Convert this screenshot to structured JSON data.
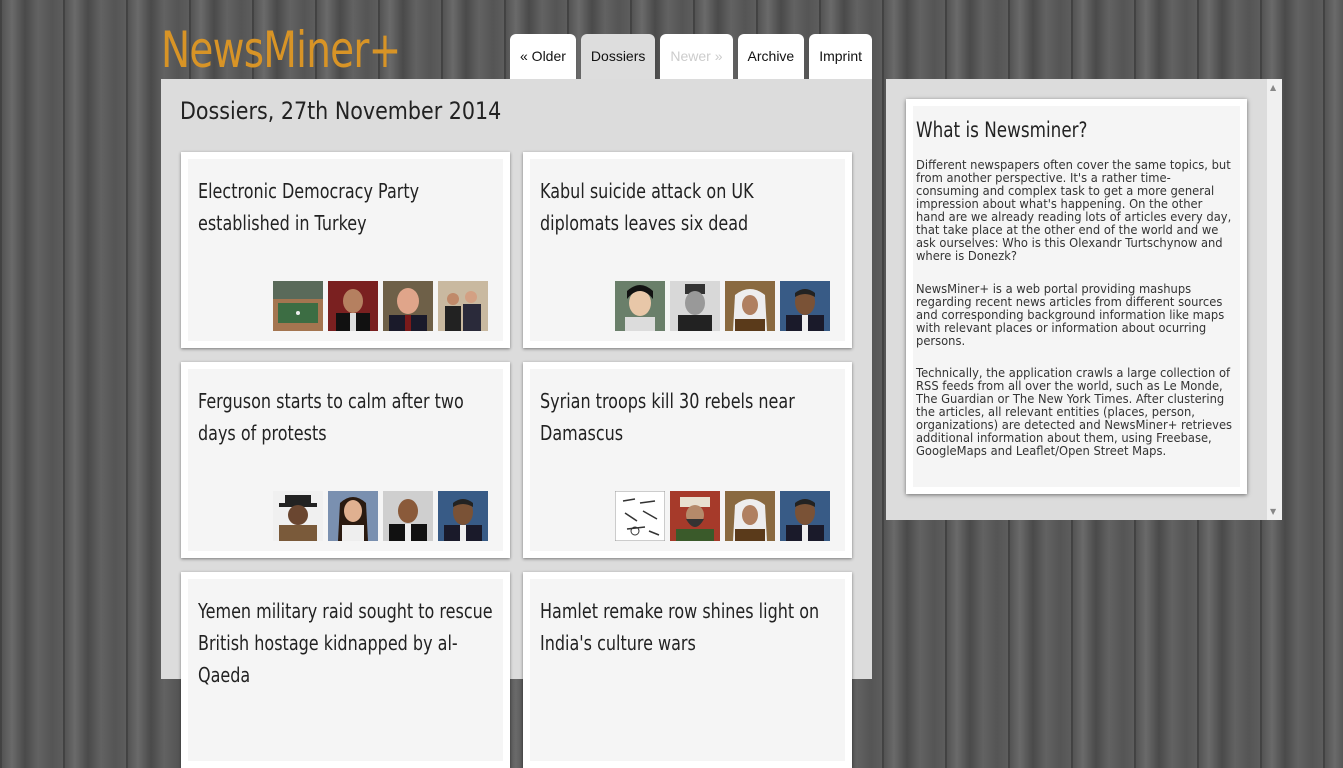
{
  "site": {
    "logo": "NewsMiner+"
  },
  "nav": {
    "older": "« Older",
    "dossiers": "Dossiers",
    "newer": "Newer »",
    "archive": "Archive",
    "imprint": "Imprint"
  },
  "main": {
    "title": "Dossiers, 27th November 2014",
    "cards": [
      {
        "title": "Electronic Democracy Party established in Turkey",
        "thumbs": [
          "tennis-court-photo",
          "politician-portrait",
          "politician-portrait",
          "group-photo"
        ]
      },
      {
        "title": "Kabul suicide attack on UK diplomats leaves six dead",
        "thumbs": [
          "woman-portrait",
          "historic-portrait",
          "king-portrait",
          "president-portrait"
        ]
      },
      {
        "title": "Ferguson starts to calm after two days of protests",
        "thumbs": [
          "man-hat-portrait",
          "woman-portrait",
          "man-portrait",
          "president-portrait"
        ]
      },
      {
        "title": "Syrian troops kill 30 rebels near Damascus",
        "thumbs": [
          "drawing-image",
          "cleric-portrait",
          "king-portrait",
          "president-portrait"
        ]
      },
      {
        "title": "Yemen military raid sought to rescue British hostage kidnapped by al-Qaeda",
        "thumbs": []
      },
      {
        "title": "Hamlet remake row shines light on India's culture wars",
        "thumbs": []
      }
    ]
  },
  "sidebar": {
    "title": "What is Newsminer?",
    "paragraphs": [
      "Different newspapers often cover the same topics, but from another perspective. It's a rather time-consuming and complex task to get a more general impression about what's happening. On the other hand are we already reading lots of articles every day, that take place at the other end of the world and we ask ourselves: Who is this Olexandr Turtschynow and where is Donezk?",
      "NewsMiner+ is a web portal providing mashups regarding recent news articles from different sources and corresponding background information like maps with relevant places or information about ocurring persons.",
      "Technically, the application crawls a large collection of RSS feeds from all over the world, such as Le Monde, The Guardian or The New York Times. After clustering the articles, all relevant entities (places, person, organizations) are detected and NewsMiner+ retrieves additional information about them, using Freebase, GoogleMaps and Leaflet/Open Street Maps."
    ]
  },
  "colors": {
    "logo": "#d89426",
    "panel": "#dcdcdc"
  }
}
